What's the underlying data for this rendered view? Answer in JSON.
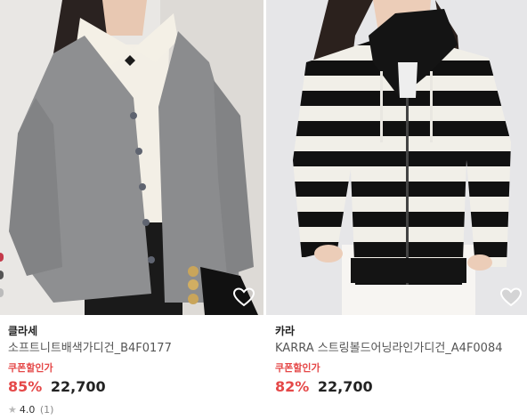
{
  "products": [
    {
      "brand": "클라세",
      "name": "소프트니트배색가디건_B4F0177",
      "coupon_label": "쿠폰할인가",
      "discount": "85%",
      "price": "22,700",
      "rating": "4.0",
      "review_count": "(1)",
      "heart_icon": "heart-outline-icon"
    },
    {
      "brand": "카라",
      "name": "KARRA 스트링볼드어닝라인가디건_A4F0084",
      "coupon_label": "쿠폰할인가",
      "discount": "82%",
      "price": "22,700",
      "heart_icon": "heart-outline-icon"
    }
  ],
  "colors": {
    "accent": "#e54848",
    "text": "#222222",
    "muted": "#555555"
  }
}
